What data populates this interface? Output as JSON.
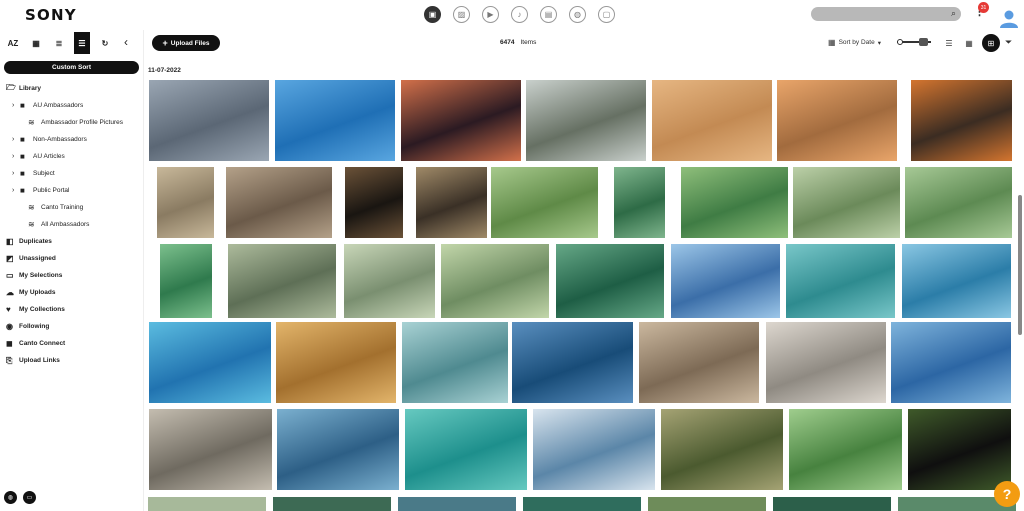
{
  "app": {
    "logo_text": "SONY"
  },
  "topbar": {
    "type_filters": [
      {
        "name": "all-types-icon",
        "glyph": "▣",
        "active": true
      },
      {
        "name": "image-icon",
        "glyph": "▨",
        "active": false
      },
      {
        "name": "video-icon",
        "glyph": "▶",
        "active": false
      },
      {
        "name": "audio-icon",
        "glyph": "♪",
        "active": false
      },
      {
        "name": "document-icon",
        "glyph": "▤",
        "active": false
      },
      {
        "name": "presentation-icon",
        "glyph": "◍",
        "active": false
      },
      {
        "name": "other-file-icon",
        "glyph": "▢",
        "active": false
      }
    ],
    "notification_count": "31"
  },
  "sidebar": {
    "tools": [
      {
        "name": "sort-alpha-button",
        "glyph": "AZ",
        "active": false
      },
      {
        "name": "calendar-button",
        "glyph": "▦",
        "active": false
      },
      {
        "name": "stack-button",
        "glyph": "≣",
        "active": false
      },
      {
        "name": "custom-sort-toggle",
        "glyph": "☰",
        "active": true
      },
      {
        "name": "refresh-button",
        "glyph": "↻",
        "active": false
      }
    ],
    "custom_sort_label": "Custom Sort",
    "items": [
      {
        "label": "Library",
        "level": 0,
        "icon": "folder-open-icon",
        "glyph": "🗁",
        "caret": "",
        "bold": true
      },
      {
        "label": "AU Ambassadors",
        "level": 1,
        "icon": "folder-icon",
        "glyph": "■",
        "caret": "›",
        "bold": false
      },
      {
        "label": "Ambassador Profile Pictures",
        "level": 2,
        "icon": "album-icon",
        "glyph": "≋",
        "caret": "",
        "bold": false
      },
      {
        "label": "Non-Ambassadors",
        "level": 1,
        "icon": "folder-icon",
        "glyph": "■",
        "caret": "›",
        "bold": false
      },
      {
        "label": "AU Articles",
        "level": 1,
        "icon": "folder-icon",
        "glyph": "■",
        "caret": "›",
        "bold": false
      },
      {
        "label": "Subject",
        "level": 1,
        "icon": "folder-icon",
        "glyph": "■",
        "caret": "›",
        "bold": false
      },
      {
        "label": "Public Portal",
        "level": 1,
        "icon": "folder-icon",
        "glyph": "■",
        "caret": "›",
        "bold": false
      },
      {
        "label": "Canto Training",
        "level": 2,
        "icon": "album-icon",
        "glyph": "≋",
        "caret": "",
        "bold": false
      },
      {
        "label": "All Ambassadors",
        "level": 2,
        "icon": "album-icon",
        "glyph": "≋",
        "caret": "",
        "bold": false
      },
      {
        "label": "Duplicates",
        "level": 0,
        "icon": "duplicates-icon",
        "glyph": "◧",
        "caret": "",
        "bold": true
      },
      {
        "label": "Unassigned",
        "level": 0,
        "icon": "unassigned-icon",
        "glyph": "◩",
        "caret": "",
        "bold": true
      },
      {
        "label": "My Selections",
        "level": 0,
        "icon": "selections-icon",
        "glyph": "▭",
        "caret": "",
        "bold": true
      },
      {
        "label": "My Uploads",
        "level": 0,
        "icon": "uploads-icon",
        "glyph": "☁",
        "caret": "",
        "bold": true
      },
      {
        "label": "My Collections",
        "level": 0,
        "icon": "heart-icon",
        "glyph": "♥",
        "caret": "",
        "bold": true
      },
      {
        "label": "Following",
        "level": 0,
        "icon": "eye-icon",
        "glyph": "◉",
        "caret": "",
        "bold": true
      },
      {
        "label": "Canto Connect",
        "level": 0,
        "icon": "connect-icon",
        "glyph": "◼",
        "caret": "",
        "bold": true
      },
      {
        "label": "Upload Links",
        "level": 0,
        "icon": "link-icon",
        "glyph": "⎘",
        "caret": "",
        "bold": true
      }
    ]
  },
  "toolbar": {
    "upload_label": "Upload Files",
    "item_count": "6474",
    "item_count_label": "Items",
    "sort_label": "Sort by Date",
    "views": [
      {
        "name": "list-view-icon",
        "glyph": "☰",
        "active": false
      },
      {
        "name": "grid-view-icon",
        "glyph": "▦",
        "active": false
      },
      {
        "name": "masonry-view-icon",
        "glyph": "⊞",
        "active": true
      }
    ]
  },
  "gallery": {
    "date_group": "11-07-2022",
    "rows": [
      {
        "tiles": [
          [
            "#5b6775",
            "#9aa6b3"
          ],
          [
            "#1f6fb5",
            "#59a6e0"
          ],
          [
            "#2b1a22",
            "#d2704a"
          ],
          [
            "#667063",
            "#c9d0cc"
          ],
          [
            "#c38a53",
            "#e6b682"
          ],
          [
            "#a26b3e",
            "#e9a56a"
          ],
          [
            "#3b2c22",
            "#d4752f"
          ]
        ]
      },
      {
        "tiles": [
          [
            "#8a7b62",
            "#c8b89a"
          ],
          [
            "#6b5a49",
            "#b4a189"
          ],
          [
            "#191511",
            "#6b5238"
          ],
          [
            "#3a3026",
            "#a08a68"
          ],
          [
            "#5f8a47",
            "#a7c98c"
          ],
          [
            "#2e6b46",
            "#7fb58d"
          ],
          [
            "#3f7c44",
            "#8fbf7b"
          ],
          [
            "#6b8a5a",
            "#bcd0a8"
          ],
          [
            "#5d8a52",
            "#a7c996"
          ]
        ]
      },
      {
        "tiles": [
          [
            "#2f7a4d",
            "#7cc08d"
          ],
          [
            "#5e6f56",
            "#adbb9c"
          ],
          [
            "#7a8f70",
            "#c8d6b8"
          ],
          [
            "#6f8d62",
            "#c2d6aa"
          ],
          [
            "#1e5e45",
            "#66a887"
          ],
          [
            "#3b6ea8",
            "#9cc6e8"
          ],
          [
            "#2e8b8f",
            "#79c7c9"
          ],
          [
            "#2b7da8",
            "#8ac7e3"
          ]
        ]
      },
      {
        "tiles": [
          [
            "#2173b0",
            "#5bbce0"
          ],
          [
            "#a3702e",
            "#e3b56b"
          ],
          [
            "#4f8a90",
            "#a9d2d4"
          ],
          [
            "#184c78",
            "#5a8fbf"
          ],
          [
            "#7d6a55",
            "#cbb89f"
          ],
          [
            "#8f8a82",
            "#ddd7cf"
          ],
          [
            "#2a9a98",
            "#7ad3cb"
          ],
          [
            "#2c66a4",
            "#7fb4dc"
          ]
        ]
      },
      {
        "tiles": [
          [
            "#6f6a60",
            "#c4bdb0"
          ],
          [
            "#2d5f86",
            "#7bb0cf"
          ],
          [
            "#1d8f8c",
            "#66c9c0"
          ],
          [
            "#5b86a8",
            "#d8e4ee"
          ],
          [
            "#4b5a2f",
            "#a5a374"
          ],
          [
            "#47823f",
            "#9fcd8d"
          ],
          [
            "#0f0f0f",
            "#3f5a2a"
          ]
        ]
      }
    ]
  }
}
